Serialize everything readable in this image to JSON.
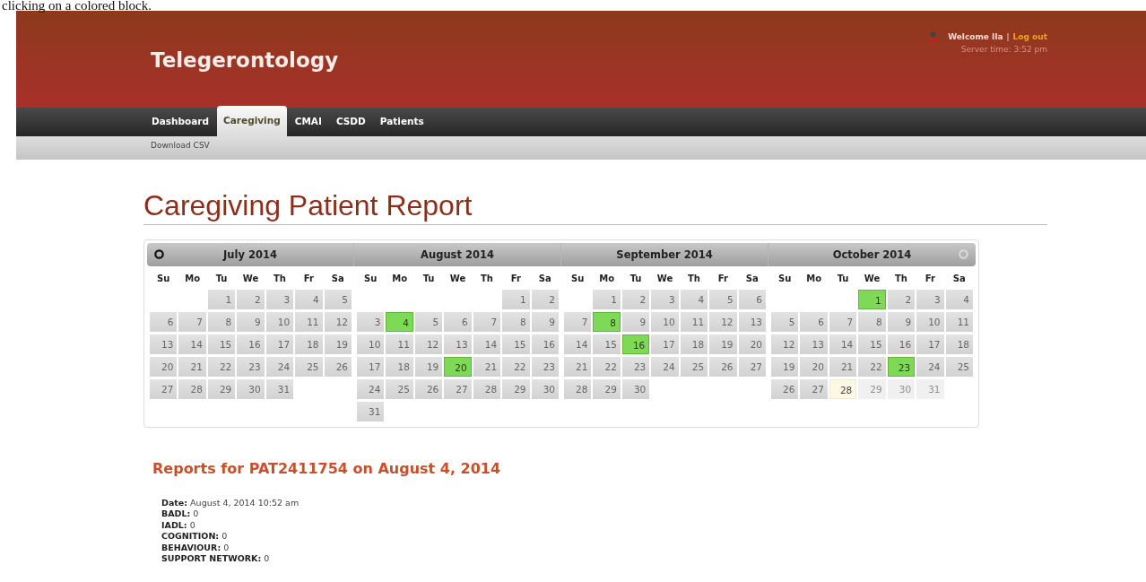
{
  "caption": "clicking on a colored block.",
  "header": {
    "title": "Telegerontology",
    "welcome": "Welcome Ila",
    "separator": "|",
    "logout": "Log out",
    "server_time": "Server time: 3:52 pm"
  },
  "tabs": [
    {
      "label": "Dashboard",
      "selected": false
    },
    {
      "label": "Caregiving",
      "selected": true
    },
    {
      "label": "CMAI",
      "selected": false
    },
    {
      "label": "CSDD",
      "selected": false
    },
    {
      "label": "Patients",
      "selected": false
    }
  ],
  "subnav": [
    "Download CSV"
  ],
  "page_title": "Caregiving Patient Report",
  "calendar": {
    "months": [
      {
        "title": "July 2014",
        "weekdays": [
          "Su",
          "Mo",
          "Tu",
          "We",
          "Th",
          "Fr",
          "Sa"
        ],
        "weeks": [
          [
            {
              "label": "1",
              "kind": "plain"
            },
            {
              "label": "2",
              "kind": "plain"
            },
            {
              "label": "3",
              "kind": "plain"
            },
            {
              "label": "4",
              "kind": "plain"
            },
            {
              "label": "5",
              "kind": "plain"
            }
          ],
          [
            {
              "label": "6",
              "kind": "plain"
            },
            {
              "label": "7",
              "kind": "plain"
            },
            {
              "label": "8",
              "kind": "plain"
            },
            {
              "label": "9",
              "kind": "plain"
            },
            {
              "label": "10",
              "kind": "plain"
            },
            {
              "label": "11",
              "kind": "plain"
            },
            {
              "label": "12",
              "kind": "plain"
            }
          ],
          [
            {
              "label": "13",
              "kind": "plain"
            },
            {
              "label": "14",
              "kind": "plain"
            },
            {
              "label": "15",
              "kind": "plain"
            },
            {
              "label": "16",
              "kind": "plain"
            },
            {
              "label": "17",
              "kind": "plain"
            },
            {
              "label": "18",
              "kind": "plain"
            },
            {
              "label": "19",
              "kind": "plain"
            }
          ],
          [
            {
              "label": "20",
              "kind": "plain"
            },
            {
              "label": "21",
              "kind": "plain"
            },
            {
              "label": "22",
              "kind": "plain"
            },
            {
              "label": "23",
              "kind": "plain"
            },
            {
              "label": "24",
              "kind": "plain"
            },
            {
              "label": "25",
              "kind": "plain"
            },
            {
              "label": "26",
              "kind": "plain"
            }
          ],
          [
            {
              "label": "27",
              "kind": "plain"
            },
            {
              "label": "28",
              "kind": "plain"
            },
            {
              "label": "29",
              "kind": "plain"
            },
            {
              "label": "30",
              "kind": "plain"
            },
            {
              "label": "31",
              "kind": "plain"
            }
          ]
        ]
      },
      {
        "title": "August 2014",
        "weekdays": [
          "Su",
          "Mo",
          "Tu",
          "We",
          "Th",
          "Fr",
          "Sa"
        ],
        "weeks": [
          [
            {
              "label": "1",
              "kind": "plain"
            },
            {
              "label": "2",
              "kind": "plain"
            }
          ],
          [
            {
              "label": "3",
              "kind": "plain"
            },
            {
              "label": "4",
              "kind": "report"
            },
            {
              "label": "5",
              "kind": "plain"
            },
            {
              "label": "6",
              "kind": "plain"
            },
            {
              "label": "7",
              "kind": "plain"
            },
            {
              "label": "8",
              "kind": "plain"
            },
            {
              "label": "9",
              "kind": "plain"
            }
          ],
          [
            {
              "label": "10",
              "kind": "plain"
            },
            {
              "label": "11",
              "kind": "plain"
            },
            {
              "label": "12",
              "kind": "plain"
            },
            {
              "label": "13",
              "kind": "plain"
            },
            {
              "label": "14",
              "kind": "plain"
            },
            {
              "label": "15",
              "kind": "plain"
            },
            {
              "label": "16",
              "kind": "plain"
            }
          ],
          [
            {
              "label": "17",
              "kind": "plain"
            },
            {
              "label": "18",
              "kind": "plain"
            },
            {
              "label": "19",
              "kind": "plain"
            },
            {
              "label": "20",
              "kind": "report"
            },
            {
              "label": "21",
              "kind": "plain"
            },
            {
              "label": "22",
              "kind": "plain"
            },
            {
              "label": "23",
              "kind": "plain"
            }
          ],
          [
            {
              "label": "24",
              "kind": "plain"
            },
            {
              "label": "25",
              "kind": "plain"
            },
            {
              "label": "26",
              "kind": "plain"
            },
            {
              "label": "27",
              "kind": "plain"
            },
            {
              "label": "28",
              "kind": "plain"
            },
            {
              "label": "29",
              "kind": "plain"
            },
            {
              "label": "30",
              "kind": "plain"
            }
          ],
          [
            {
              "label": "31",
              "kind": "plain"
            }
          ]
        ]
      },
      {
        "title": "September 2014",
        "weekdays": [
          "Su",
          "Mo",
          "Tu",
          "We",
          "Th",
          "Fr",
          "Sa"
        ],
        "weeks": [
          [
            {
              "label": "1",
              "kind": "plain"
            },
            {
              "label": "2",
              "kind": "plain"
            },
            {
              "label": "3",
              "kind": "plain"
            },
            {
              "label": "4",
              "kind": "plain"
            },
            {
              "label": "5",
              "kind": "plain"
            },
            {
              "label": "6",
              "kind": "plain"
            }
          ],
          [
            {
              "label": "7",
              "kind": "plain"
            },
            {
              "label": "8",
              "kind": "report"
            },
            {
              "label": "9",
              "kind": "plain"
            },
            {
              "label": "10",
              "kind": "plain"
            },
            {
              "label": "11",
              "kind": "plain"
            },
            {
              "label": "12",
              "kind": "plain"
            },
            {
              "label": "13",
              "kind": "plain"
            }
          ],
          [
            {
              "label": "14",
              "kind": "plain"
            },
            {
              "label": "15",
              "kind": "plain"
            },
            {
              "label": "16",
              "kind": "report"
            },
            {
              "label": "17",
              "kind": "plain"
            },
            {
              "label": "18",
              "kind": "plain"
            },
            {
              "label": "19",
              "kind": "plain"
            },
            {
              "label": "20",
              "kind": "plain"
            }
          ],
          [
            {
              "label": "21",
              "kind": "plain"
            },
            {
              "label": "22",
              "kind": "plain"
            },
            {
              "label": "23",
              "kind": "plain"
            },
            {
              "label": "24",
              "kind": "plain"
            },
            {
              "label": "25",
              "kind": "plain"
            },
            {
              "label": "26",
              "kind": "plain"
            },
            {
              "label": "27",
              "kind": "plain"
            }
          ],
          [
            {
              "label": "28",
              "kind": "plain"
            },
            {
              "label": "29",
              "kind": "plain"
            },
            {
              "label": "30",
              "kind": "plain"
            }
          ]
        ]
      },
      {
        "title": "October 2014",
        "weekdays": [
          "Su",
          "Mo",
          "Tu",
          "We",
          "Th",
          "Fr",
          "Sa"
        ],
        "weeks": [
          [
            {
              "label": "1",
              "kind": "report"
            },
            {
              "label": "2",
              "kind": "plain"
            },
            {
              "label": "3",
              "kind": "plain"
            },
            {
              "label": "4",
              "kind": "plain"
            }
          ],
          [
            {
              "label": "5",
              "kind": "plain"
            },
            {
              "label": "6",
              "kind": "plain"
            },
            {
              "label": "7",
              "kind": "plain"
            },
            {
              "label": "8",
              "kind": "plain"
            },
            {
              "label": "9",
              "kind": "plain"
            },
            {
              "label": "10",
              "kind": "plain"
            },
            {
              "label": "11",
              "kind": "plain"
            }
          ],
          [
            {
              "label": "12",
              "kind": "plain"
            },
            {
              "label": "13",
              "kind": "plain"
            },
            {
              "label": "14",
              "kind": "plain"
            },
            {
              "label": "15",
              "kind": "plain"
            },
            {
              "label": "16",
              "kind": "plain"
            },
            {
              "label": "17",
              "kind": "plain"
            },
            {
              "label": "18",
              "kind": "plain"
            }
          ],
          [
            {
              "label": "19",
              "kind": "plain"
            },
            {
              "label": "20",
              "kind": "plain"
            },
            {
              "label": "21",
              "kind": "plain"
            },
            {
              "label": "22",
              "kind": "plain"
            },
            {
              "label": "23",
              "kind": "report"
            },
            {
              "label": "24",
              "kind": "plain"
            },
            {
              "label": "25",
              "kind": "plain"
            }
          ],
          [
            {
              "label": "26",
              "kind": "plain"
            },
            {
              "label": "27",
              "kind": "plain"
            },
            {
              "label": "28",
              "kind": "today"
            },
            {
              "label": "29",
              "kind": "disabled"
            },
            {
              "label": "30",
              "kind": "disabled"
            },
            {
              "label": "31",
              "kind": "disabled"
            }
          ]
        ]
      }
    ]
  },
  "report": {
    "heading": "Reports for PAT2411754 on August 4, 2014",
    "fields": [
      {
        "label": "Date:",
        "value": "August 4, 2014 10:52 am"
      },
      {
        "label": "BADL:",
        "value": "0"
      },
      {
        "label": "IADL:",
        "value": "0"
      },
      {
        "label": "COGNITION:",
        "value": "0"
      },
      {
        "label": "BEHAVIOUR:",
        "value": "0"
      },
      {
        "label": "SUPPORT NETWORK:",
        "value": "0"
      }
    ]
  }
}
